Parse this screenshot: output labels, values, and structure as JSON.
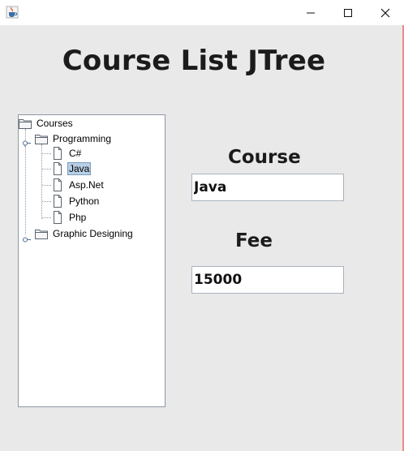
{
  "window": {
    "icon": "java-cup-icon",
    "controls": [
      "minimize-icon",
      "maximize-icon",
      "close-icon"
    ]
  },
  "header": {
    "title": "Course List JTree"
  },
  "tree": {
    "root": "Courses",
    "nodes": [
      {
        "label": "Programming",
        "expanded": true,
        "children": [
          "C#",
          "Java",
          "Asp.Net",
          "Python",
          "Php"
        ],
        "selected": "Java"
      },
      {
        "label": "Graphic Designing",
        "expanded": false
      }
    ]
  },
  "form": {
    "course_label": "Course",
    "course_value": "Java",
    "fee_label": "Fee",
    "fee_value": "15000"
  },
  "colors": {
    "background": "#e9e9e9",
    "selection": "#b8cfe5",
    "text": "#1b1b1b"
  }
}
